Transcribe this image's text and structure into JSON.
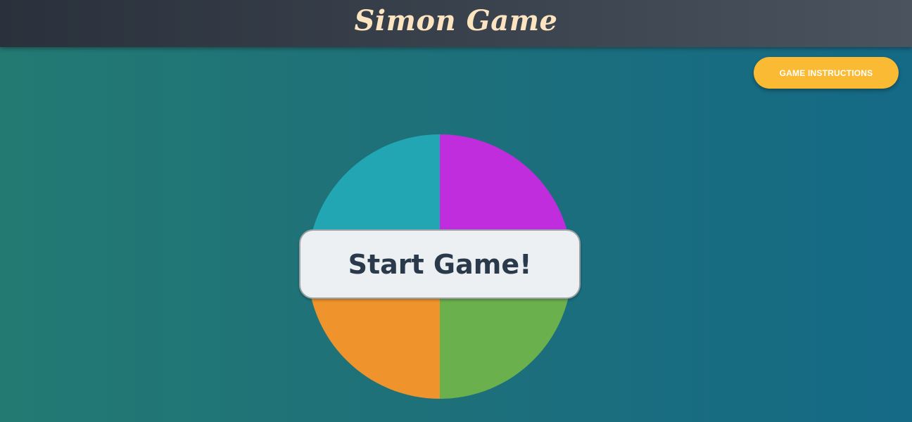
{
  "header": {
    "title": "Simon Game"
  },
  "instructions_button": {
    "label": "GAME INSTRUCTIONS",
    "color": "#fbba33"
  },
  "start_button": {
    "label": "Start Game!"
  },
  "board": {
    "pads": [
      {
        "name": "top-left",
        "color": "#23a6b3"
      },
      {
        "name": "top-right",
        "color": "#bf2ddd"
      },
      {
        "name": "bottom-left",
        "color": "#ef932c"
      },
      {
        "name": "bottom-right",
        "color": "#6ab04c"
      }
    ]
  },
  "theme": {
    "header_text_color": "#fde4c0",
    "start_text_color": "#2b3a4b"
  }
}
